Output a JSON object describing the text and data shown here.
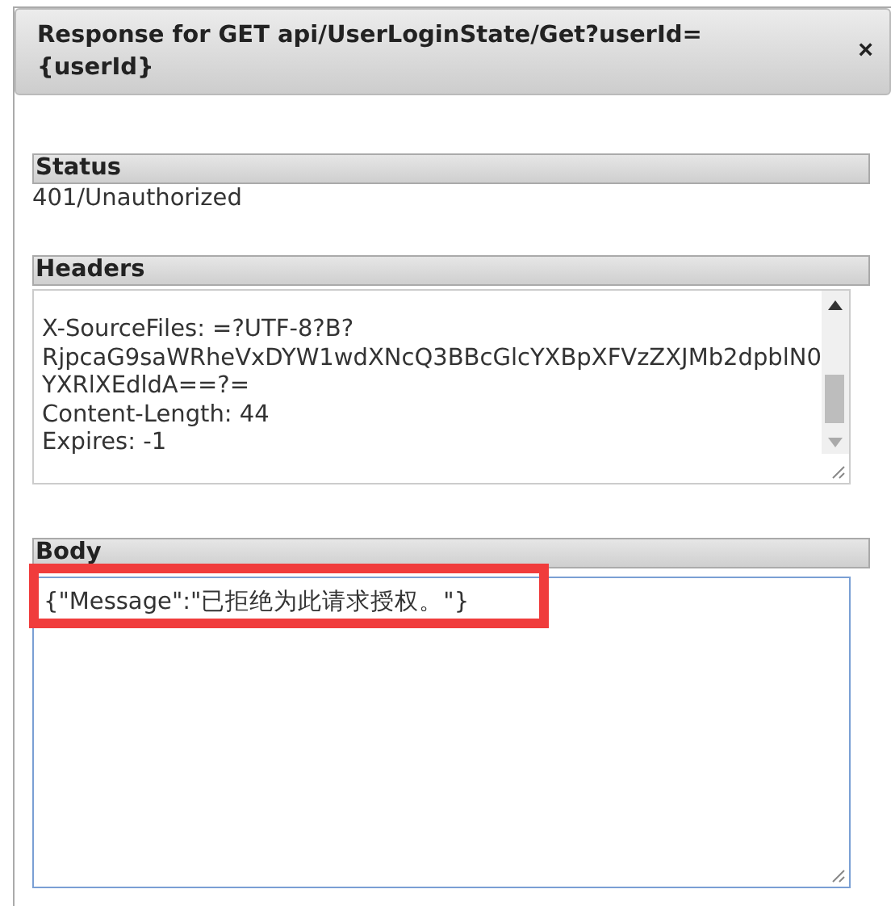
{
  "dialog": {
    "title": "Response for GET api/UserLoginState/Get?userId={userId}",
    "close": "×"
  },
  "status": {
    "heading": "Status",
    "value": "401/Unauthorized"
  },
  "headers": {
    "heading": "Headers",
    "lines": [
      "X-SourceFiles: =?UTF-8?B?RjpcaG9saWRheVxDYW1wdXNcQ3BBcGlcYXBpXFVzZXJMb2dpblN0YXRlXEdldA==?=",
      "Content-Length: 44",
      "Expires: -1"
    ]
  },
  "body": {
    "heading": "Body",
    "value": "{\"Message\":\"已拒绝为此请求授权。\"}",
    "highlighted": true
  }
}
